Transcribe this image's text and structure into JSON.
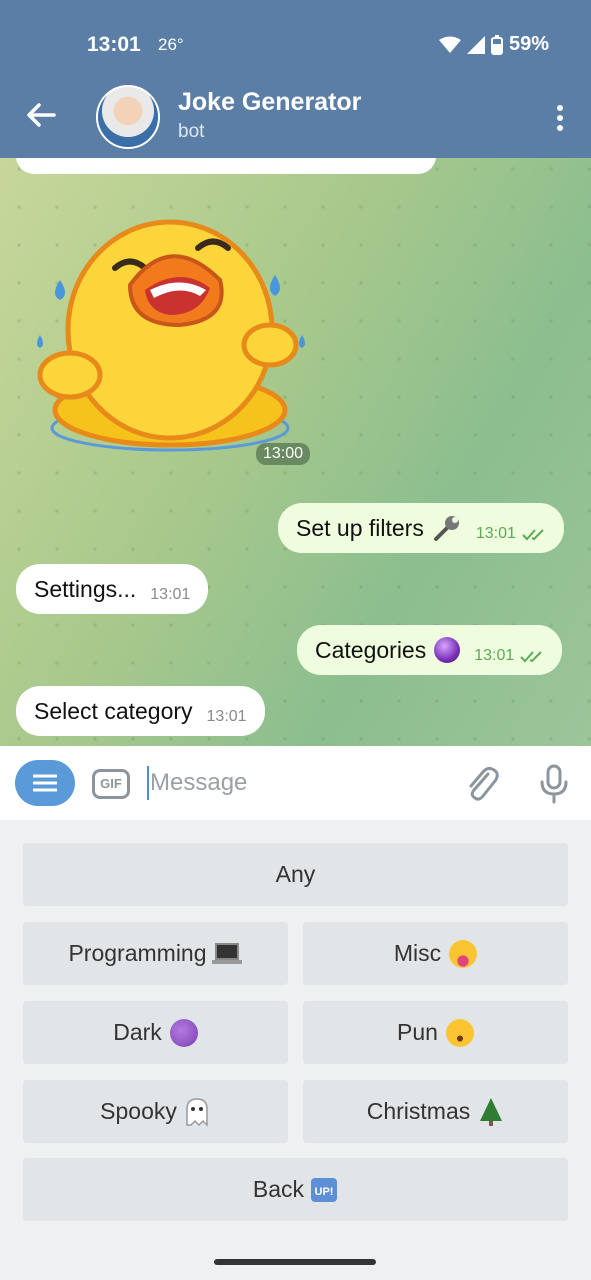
{
  "status_bar": {
    "time": "13:01",
    "temperature": "26°",
    "battery": "59%"
  },
  "header": {
    "title": "Joke Generator",
    "subtitle": "bot"
  },
  "messages": [
    {
      "dir": "in",
      "type": "sticker",
      "time": "13:00"
    },
    {
      "dir": "out",
      "text": "Set up filters",
      "emoji": "wrench",
      "time": "13:01"
    },
    {
      "dir": "in",
      "text": "Settings...",
      "time": "13:01"
    },
    {
      "dir": "out",
      "text": "Categories",
      "emoji": "crystal-ball",
      "time": "13:01"
    },
    {
      "dir": "in",
      "text": "Select category",
      "time": "13:01"
    }
  ],
  "input": {
    "placeholder": "Message",
    "gif_label": "GIF"
  },
  "keyboard": {
    "buttons": [
      {
        "label": "Any"
      },
      {
        "label": "Programming",
        "emoji": "laptop"
      },
      {
        "label": "Misc",
        "emoji": "squinting-tongue"
      },
      {
        "label": "Dark",
        "emoji": "smiling-imp"
      },
      {
        "label": "Pun",
        "emoji": "hushed-face"
      },
      {
        "label": "Spooky",
        "emoji": "ghost"
      },
      {
        "label": "Christmas",
        "emoji": "christmas-tree"
      },
      {
        "label": "Back",
        "emoji": "up-button"
      }
    ]
  },
  "colors": {
    "header": "#5b7ea6",
    "outgoing": "#effdde",
    "accent": "#5a9ad8"
  }
}
